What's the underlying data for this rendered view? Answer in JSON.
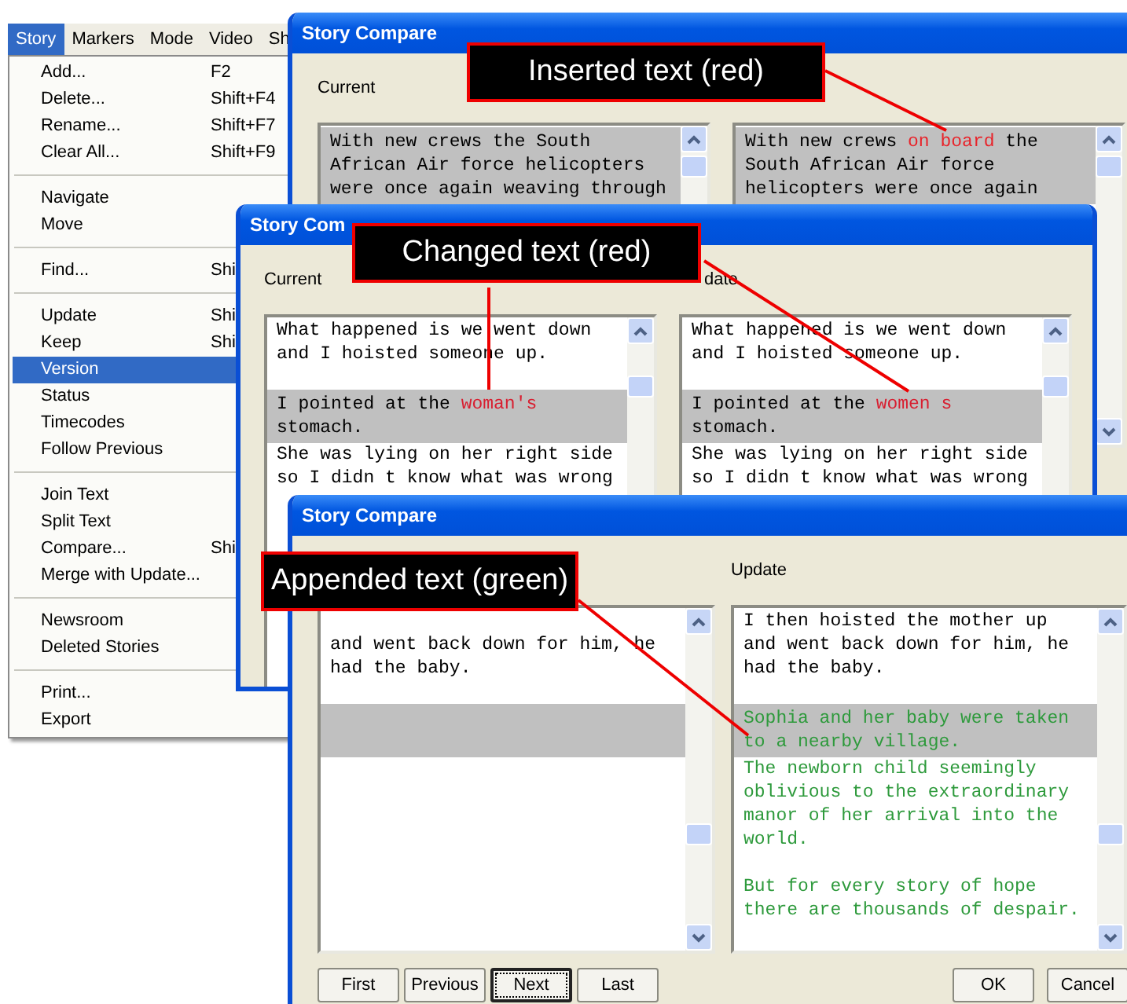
{
  "menu_bar": [
    {
      "label": "Story",
      "selected": true
    },
    {
      "label": "Markers",
      "selected": false
    },
    {
      "label": "Mode",
      "selected": false
    },
    {
      "label": "Video",
      "selected": false
    },
    {
      "label": "Sh",
      "selected": false
    }
  ],
  "menu": [
    {
      "kind": "item",
      "label": "Add...",
      "shortcut": "F2",
      "selected": false
    },
    {
      "kind": "item",
      "label": "Delete...",
      "shortcut": "Shift+F4",
      "selected": false
    },
    {
      "kind": "item",
      "label": "Rename...",
      "shortcut": "Shift+F7",
      "selected": false
    },
    {
      "kind": "item",
      "label": "Clear All...",
      "shortcut": "Shift+F9",
      "selected": false
    },
    {
      "kind": "separator"
    },
    {
      "kind": "item",
      "label": "Navigate",
      "selected": false
    },
    {
      "kind": "item",
      "label": "Move",
      "selected": false
    },
    {
      "kind": "separator"
    },
    {
      "kind": "item",
      "label": "Find...",
      "shortcut": "Shi",
      "selected": false
    },
    {
      "kind": "separator"
    },
    {
      "kind": "item",
      "label": "Update",
      "shortcut": "Shi",
      "selected": false
    },
    {
      "kind": "item",
      "label": "Keep",
      "shortcut": "Shi",
      "selected": false
    },
    {
      "kind": "item",
      "label": "Version",
      "selected": true
    },
    {
      "kind": "item",
      "label": "Status",
      "selected": false
    },
    {
      "kind": "item",
      "label": "Timecodes",
      "selected": false
    },
    {
      "kind": "item",
      "label": "Follow Previous",
      "selected": false
    },
    {
      "kind": "separator"
    },
    {
      "kind": "item",
      "label": "Join Text",
      "selected": false
    },
    {
      "kind": "item",
      "label": "Split Text",
      "selected": false
    },
    {
      "kind": "item",
      "label": "Compare...",
      "shortcut": "Shi",
      "selected": false
    },
    {
      "kind": "item",
      "label": "Merge with Update...",
      "selected": false
    },
    {
      "kind": "separator"
    },
    {
      "kind": "item",
      "label": "Newsroom",
      "selected": false
    },
    {
      "kind": "item",
      "label": "Deleted Stories",
      "selected": false
    },
    {
      "kind": "separator"
    },
    {
      "kind": "item",
      "label": "Print...",
      "selected": false
    },
    {
      "kind": "item",
      "label": "Export",
      "selected": false
    }
  ],
  "windows": [
    {
      "title": "Story Compare",
      "panes": [
        {
          "label": "Current",
          "paragraphs": [
            {
              "kind": "plain",
              "highlighted": true,
              "space_before": false,
              "lines": [
                [
                  "With new crews the South"
                ],
                [
                  "African Air force helicopters"
                ],
                [
                  "were once again weaving through"
                ]
              ]
            }
          ]
        },
        {
          "paragraphs": [
            {
              "kind": "plain",
              "highlighted": true,
              "space_before": false,
              "lines": [
                [
                  "With new crews ",
                  {
                    "text": "on board",
                    "kind": "inserted"
                  },
                  " the"
                ],
                [
                  "South African Air force"
                ],
                [
                  "helicopters were once again"
                ]
              ]
            }
          ]
        }
      ]
    },
    {
      "title": "Story Com",
      "panes": [
        {
          "label": "Current",
          "paragraphs": [
            {
              "kind": "plain",
              "highlighted": false,
              "space_before": false,
              "lines": [
                [
                  "What happened is we went down"
                ],
                [
                  "and I hoisted someone up."
                ]
              ]
            },
            {
              "kind": "plain",
              "highlighted": true,
              "space_before": true,
              "lines": [
                [
                  "I pointed at the ",
                  {
                    "text": "woman's",
                    "kind": "changed"
                  }
                ],
                [
                  "stomach."
                ]
              ]
            },
            {
              "kind": "plain",
              "highlighted": false,
              "space_before": false,
              "lines": [
                [
                  "She was lying on her right side"
                ],
                [
                  "so I didn t know what was wrong"
                ]
              ]
            }
          ]
        },
        {
          "label": "date",
          "paragraphs": [
            {
              "kind": "plain",
              "highlighted": false,
              "space_before": false,
              "lines": [
                [
                  "What happened is we went down"
                ],
                [
                  "and I hoisted someone up."
                ]
              ]
            },
            {
              "kind": "plain",
              "highlighted": true,
              "space_before": true,
              "lines": [
                [
                  "I pointed at the ",
                  {
                    "text": "women s",
                    "kind": "changed"
                  }
                ],
                [
                  "stomach."
                ]
              ]
            },
            {
              "kind": "plain",
              "highlighted": false,
              "space_before": false,
              "lines": [
                [
                  "She was lying on her right side"
                ],
                [
                  "so I didn t know what was wrong"
                ]
              ]
            }
          ]
        }
      ]
    },
    {
      "title": "Story Compare",
      "panes": [
        {
          "paragraphs": [
            {
              "kind": "plain",
              "highlighted": false,
              "space_before": false,
              "lines": [
                [
                  "and went back down for him, he"
                ],
                [
                  "had the baby."
                ]
              ]
            },
            {
              "kind": "blank",
              "highlighted": true,
              "space_before": true
            }
          ]
        },
        {
          "label": "Update",
          "paragraphs": [
            {
              "kind": "plain",
              "highlighted": false,
              "space_before": false,
              "lines": [
                [
                  "I then hoisted the mother up"
                ],
                [
                  "and went back down for him, he"
                ],
                [
                  "had the baby."
                ]
              ]
            },
            {
              "kind": "appended",
              "highlighted": true,
              "space_before": true,
              "lines": [
                [
                  "Sophia and her baby were taken"
                ],
                [
                  "to a nearby village."
                ]
              ]
            },
            {
              "kind": "appended",
              "highlighted": false,
              "space_before": false,
              "lines": [
                [
                  "The newborn child seemingly"
                ],
                [
                  "oblivious to the extraordinary"
                ],
                [
                  "manor of her arrival into the"
                ],
                [
                  "world."
                ]
              ]
            },
            {
              "kind": "appended",
              "highlighted": false,
              "space_before": true,
              "lines": [
                [
                  "But for every story of hope"
                ],
                [
                  "there are thousands of despair."
                ]
              ]
            }
          ]
        }
      ],
      "nav_buttons": [
        {
          "label": "First",
          "focused": false
        },
        {
          "label": "Previous",
          "focused": false
        },
        {
          "label": "Next",
          "focused": true
        },
        {
          "label": "Last",
          "focused": false
        }
      ],
      "dialog_buttons": [
        {
          "label": "OK"
        },
        {
          "label": "Cancel"
        }
      ]
    }
  ],
  "callouts": [
    {
      "text": "Inserted text (red)"
    },
    {
      "text": "Changed text (red)"
    },
    {
      "text": "Appended text (green)"
    }
  ]
}
